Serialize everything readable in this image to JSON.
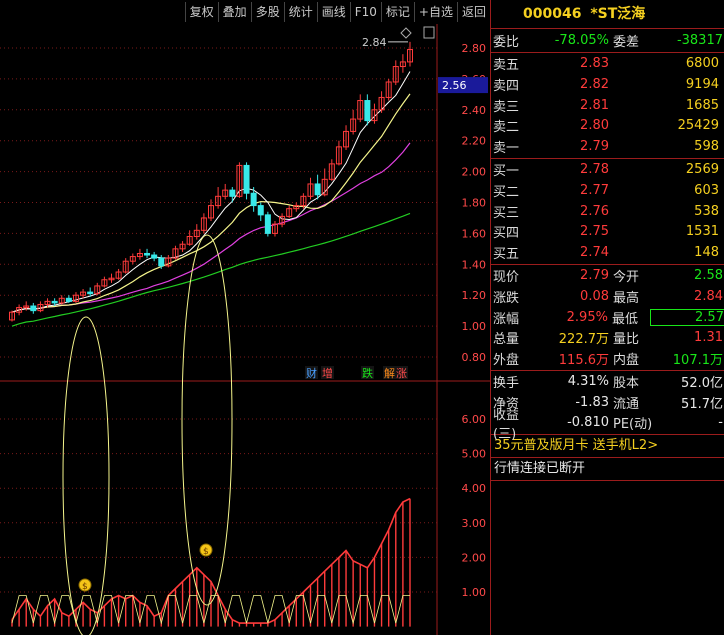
{
  "toolbar": {
    "buttons": [
      "复权",
      "叠加",
      "多股",
      "统计",
      "画线",
      "F10",
      "标记",
      "+自选",
      "返回"
    ]
  },
  "chart": {
    "price_axis": [
      "2.80",
      "2.60",
      "2.40",
      "2.20",
      "2.00",
      "1.80",
      "1.60",
      "1.40",
      "1.20",
      "1.00",
      "0.80"
    ],
    "current_price_tag": "2.56",
    "high_label": "2.84",
    "indicator_axis": [
      "6.00",
      "5.00",
      "4.00",
      "3.00",
      "2.00",
      "1.00"
    ],
    "event_labels": [
      "财",
      "增",
      "跌",
      "解",
      "涨"
    ],
    "candles": [
      [
        1.04,
        1.09,
        1.03,
        1.1
      ],
      [
        1.09,
        1.12,
        1.07,
        1.14
      ],
      [
        1.12,
        1.13,
        1.1,
        1.16
      ],
      [
        1.13,
        1.1,
        1.08,
        1.15
      ],
      [
        1.1,
        1.14,
        1.09,
        1.16
      ],
      [
        1.14,
        1.16,
        1.12,
        1.18
      ],
      [
        1.16,
        1.15,
        1.13,
        1.18
      ],
      [
        1.15,
        1.18,
        1.14,
        1.2
      ],
      [
        1.18,
        1.16,
        1.15,
        1.2
      ],
      [
        1.16,
        1.2,
        1.15,
        1.22
      ],
      [
        1.2,
        1.22,
        1.18,
        1.24
      ],
      [
        1.22,
        1.21,
        1.19,
        1.25
      ],
      [
        1.21,
        1.26,
        1.2,
        1.28
      ],
      [
        1.26,
        1.3,
        1.25,
        1.32
      ],
      [
        1.3,
        1.31,
        1.28,
        1.34
      ],
      [
        1.31,
        1.35,
        1.3,
        1.37
      ],
      [
        1.35,
        1.42,
        1.34,
        1.44
      ],
      [
        1.42,
        1.45,
        1.4,
        1.47
      ],
      [
        1.45,
        1.47,
        1.43,
        1.5
      ],
      [
        1.47,
        1.46,
        1.44,
        1.5
      ],
      [
        1.46,
        1.44,
        1.42,
        1.48
      ],
      [
        1.44,
        1.39,
        1.37,
        1.46
      ],
      [
        1.39,
        1.44,
        1.38,
        1.46
      ],
      [
        1.44,
        1.5,
        1.43,
        1.52
      ],
      [
        1.5,
        1.53,
        1.48,
        1.55
      ],
      [
        1.53,
        1.58,
        1.52,
        1.62
      ],
      [
        1.58,
        1.62,
        1.56,
        1.66
      ],
      [
        1.62,
        1.7,
        1.6,
        1.73
      ],
      [
        1.7,
        1.78,
        1.68,
        1.82
      ],
      [
        1.78,
        1.84,
        1.76,
        1.9
      ],
      [
        1.84,
        1.88,
        1.82,
        1.92
      ],
      [
        1.88,
        1.84,
        1.8,
        1.9
      ],
      [
        1.84,
        2.04,
        1.83,
        2.06
      ],
      [
        2.04,
        1.86,
        1.82,
        2.06
      ],
      [
        1.86,
        1.78,
        1.74,
        1.9
      ],
      [
        1.78,
        1.72,
        1.68,
        1.8
      ],
      [
        1.72,
        1.6,
        1.58,
        1.74
      ],
      [
        1.6,
        1.66,
        1.58,
        1.68
      ],
      [
        1.66,
        1.71,
        1.64,
        1.73
      ],
      [
        1.71,
        1.76,
        1.7,
        1.78
      ],
      [
        1.76,
        1.78,
        1.74,
        1.8
      ],
      [
        1.78,
        1.84,
        1.76,
        1.86
      ],
      [
        1.84,
        1.92,
        1.82,
        1.96
      ],
      [
        1.92,
        1.85,
        1.82,
        1.98
      ],
      [
        1.85,
        1.95,
        1.84,
        2.02
      ],
      [
        1.95,
        2.05,
        1.94,
        2.08
      ],
      [
        2.05,
        2.16,
        2.04,
        2.2
      ],
      [
        2.16,
        2.26,
        2.14,
        2.3
      ],
      [
        2.26,
        2.34,
        2.24,
        2.4
      ],
      [
        2.34,
        2.46,
        2.32,
        2.5
      ],
      [
        2.46,
        2.33,
        2.3,
        2.5
      ],
      [
        2.33,
        2.4,
        2.31,
        2.44
      ],
      [
        2.4,
        2.48,
        2.38,
        2.52
      ],
      [
        2.48,
        2.58,
        2.46,
        2.6
      ],
      [
        2.58,
        2.68,
        2.56,
        2.72
      ],
      [
        2.68,
        2.71,
        2.64,
        2.76
      ],
      [
        2.71,
        2.79,
        2.68,
        2.84
      ]
    ],
    "indicator_bars": [
      0.2,
      0.5,
      0.8,
      0.5,
      0.3,
      0.6,
      0.8,
      0.4,
      0.3,
      0.5,
      0.7,
      0.5,
      0.4,
      0.6,
      0.8,
      0.9,
      0.8,
      0.9,
      0.7,
      0.6,
      0.3,
      0.4,
      0.9,
      1.1,
      1.3,
      1.5,
      1.7,
      1.5,
      1.3,
      0.9,
      0.5,
      0.2,
      0.1,
      0.1,
      0.1,
      0.1,
      0.1,
      0.2,
      0.4,
      0.6,
      0.8,
      1.0,
      1.2,
      1.4,
      1.6,
      1.8,
      2.0,
      2.2,
      1.9,
      1.8,
      1.7,
      2.0,
      2.4,
      2.8,
      3.3,
      3.6,
      3.7
    ]
  },
  "panel": {
    "code": "000046",
    "name": "*ST泛海",
    "webi_label": "委比",
    "webi_value": "-78.05%",
    "weicha_label": "委差",
    "weicha_value": "-38317",
    "asks": [
      {
        "label": "卖五",
        "price": "2.83",
        "vol": "6800"
      },
      {
        "label": "卖四",
        "price": "2.82",
        "vol": "9194"
      },
      {
        "label": "卖三",
        "price": "2.81",
        "vol": "1685"
      },
      {
        "label": "卖二",
        "price": "2.80",
        "vol": "25429"
      },
      {
        "label": "卖一",
        "price": "2.79",
        "vol": "598"
      }
    ],
    "bids": [
      {
        "label": "买一",
        "price": "2.78",
        "vol": "2569"
      },
      {
        "label": "买二",
        "price": "2.77",
        "vol": "603"
      },
      {
        "label": "买三",
        "price": "2.76",
        "vol": "538"
      },
      {
        "label": "买四",
        "price": "2.75",
        "vol": "1531"
      },
      {
        "label": "买五",
        "price": "2.74",
        "vol": "148"
      }
    ],
    "stats": [
      {
        "l1": "现价",
        "v1": "2.79",
        "c1": "red",
        "l2": "今开",
        "v2": "2.58",
        "c2": "green"
      },
      {
        "l1": "涨跌",
        "v1": "0.08",
        "c1": "red",
        "l2": "最高",
        "v2": "2.84",
        "c2": "red"
      },
      {
        "l1": "涨幅",
        "v1": "2.95%",
        "c1": "red",
        "l2": "最低",
        "v2": "2.57",
        "c2": "green"
      },
      {
        "l1": "总量",
        "v1": "222.7万",
        "c1": "yellow",
        "l2": "量比",
        "v2": "1.31",
        "c2": "red"
      },
      {
        "l1": "外盘",
        "v1": "115.6万",
        "c1": "red",
        "l2": "内盘",
        "v2": "107.1万",
        "c2": "green"
      }
    ],
    "fin": [
      {
        "l1": "换手",
        "v1": "4.31%",
        "l2": "股本",
        "v2": "52.0亿"
      },
      {
        "l1": "净资",
        "v1": "-1.83",
        "l2": "流通",
        "v2": "51.7亿"
      },
      {
        "l1": "收益(三)",
        "v1": "-0.810",
        "l2": "PE(动)",
        "v2": "-"
      }
    ],
    "promo": "35元普及版月卡 送手机L2>",
    "status": "行情连接已断开"
  },
  "colors": {
    "up": "#ff3b3b",
    "down": "#19e619",
    "ma5": "#ffffff",
    "ma10": "#f5f58c",
    "ma20": "#e040e0",
    "ma60": "#22cc22",
    "highlight_ellipse": "#f5f58c",
    "frame": "#9b1c1c"
  }
}
